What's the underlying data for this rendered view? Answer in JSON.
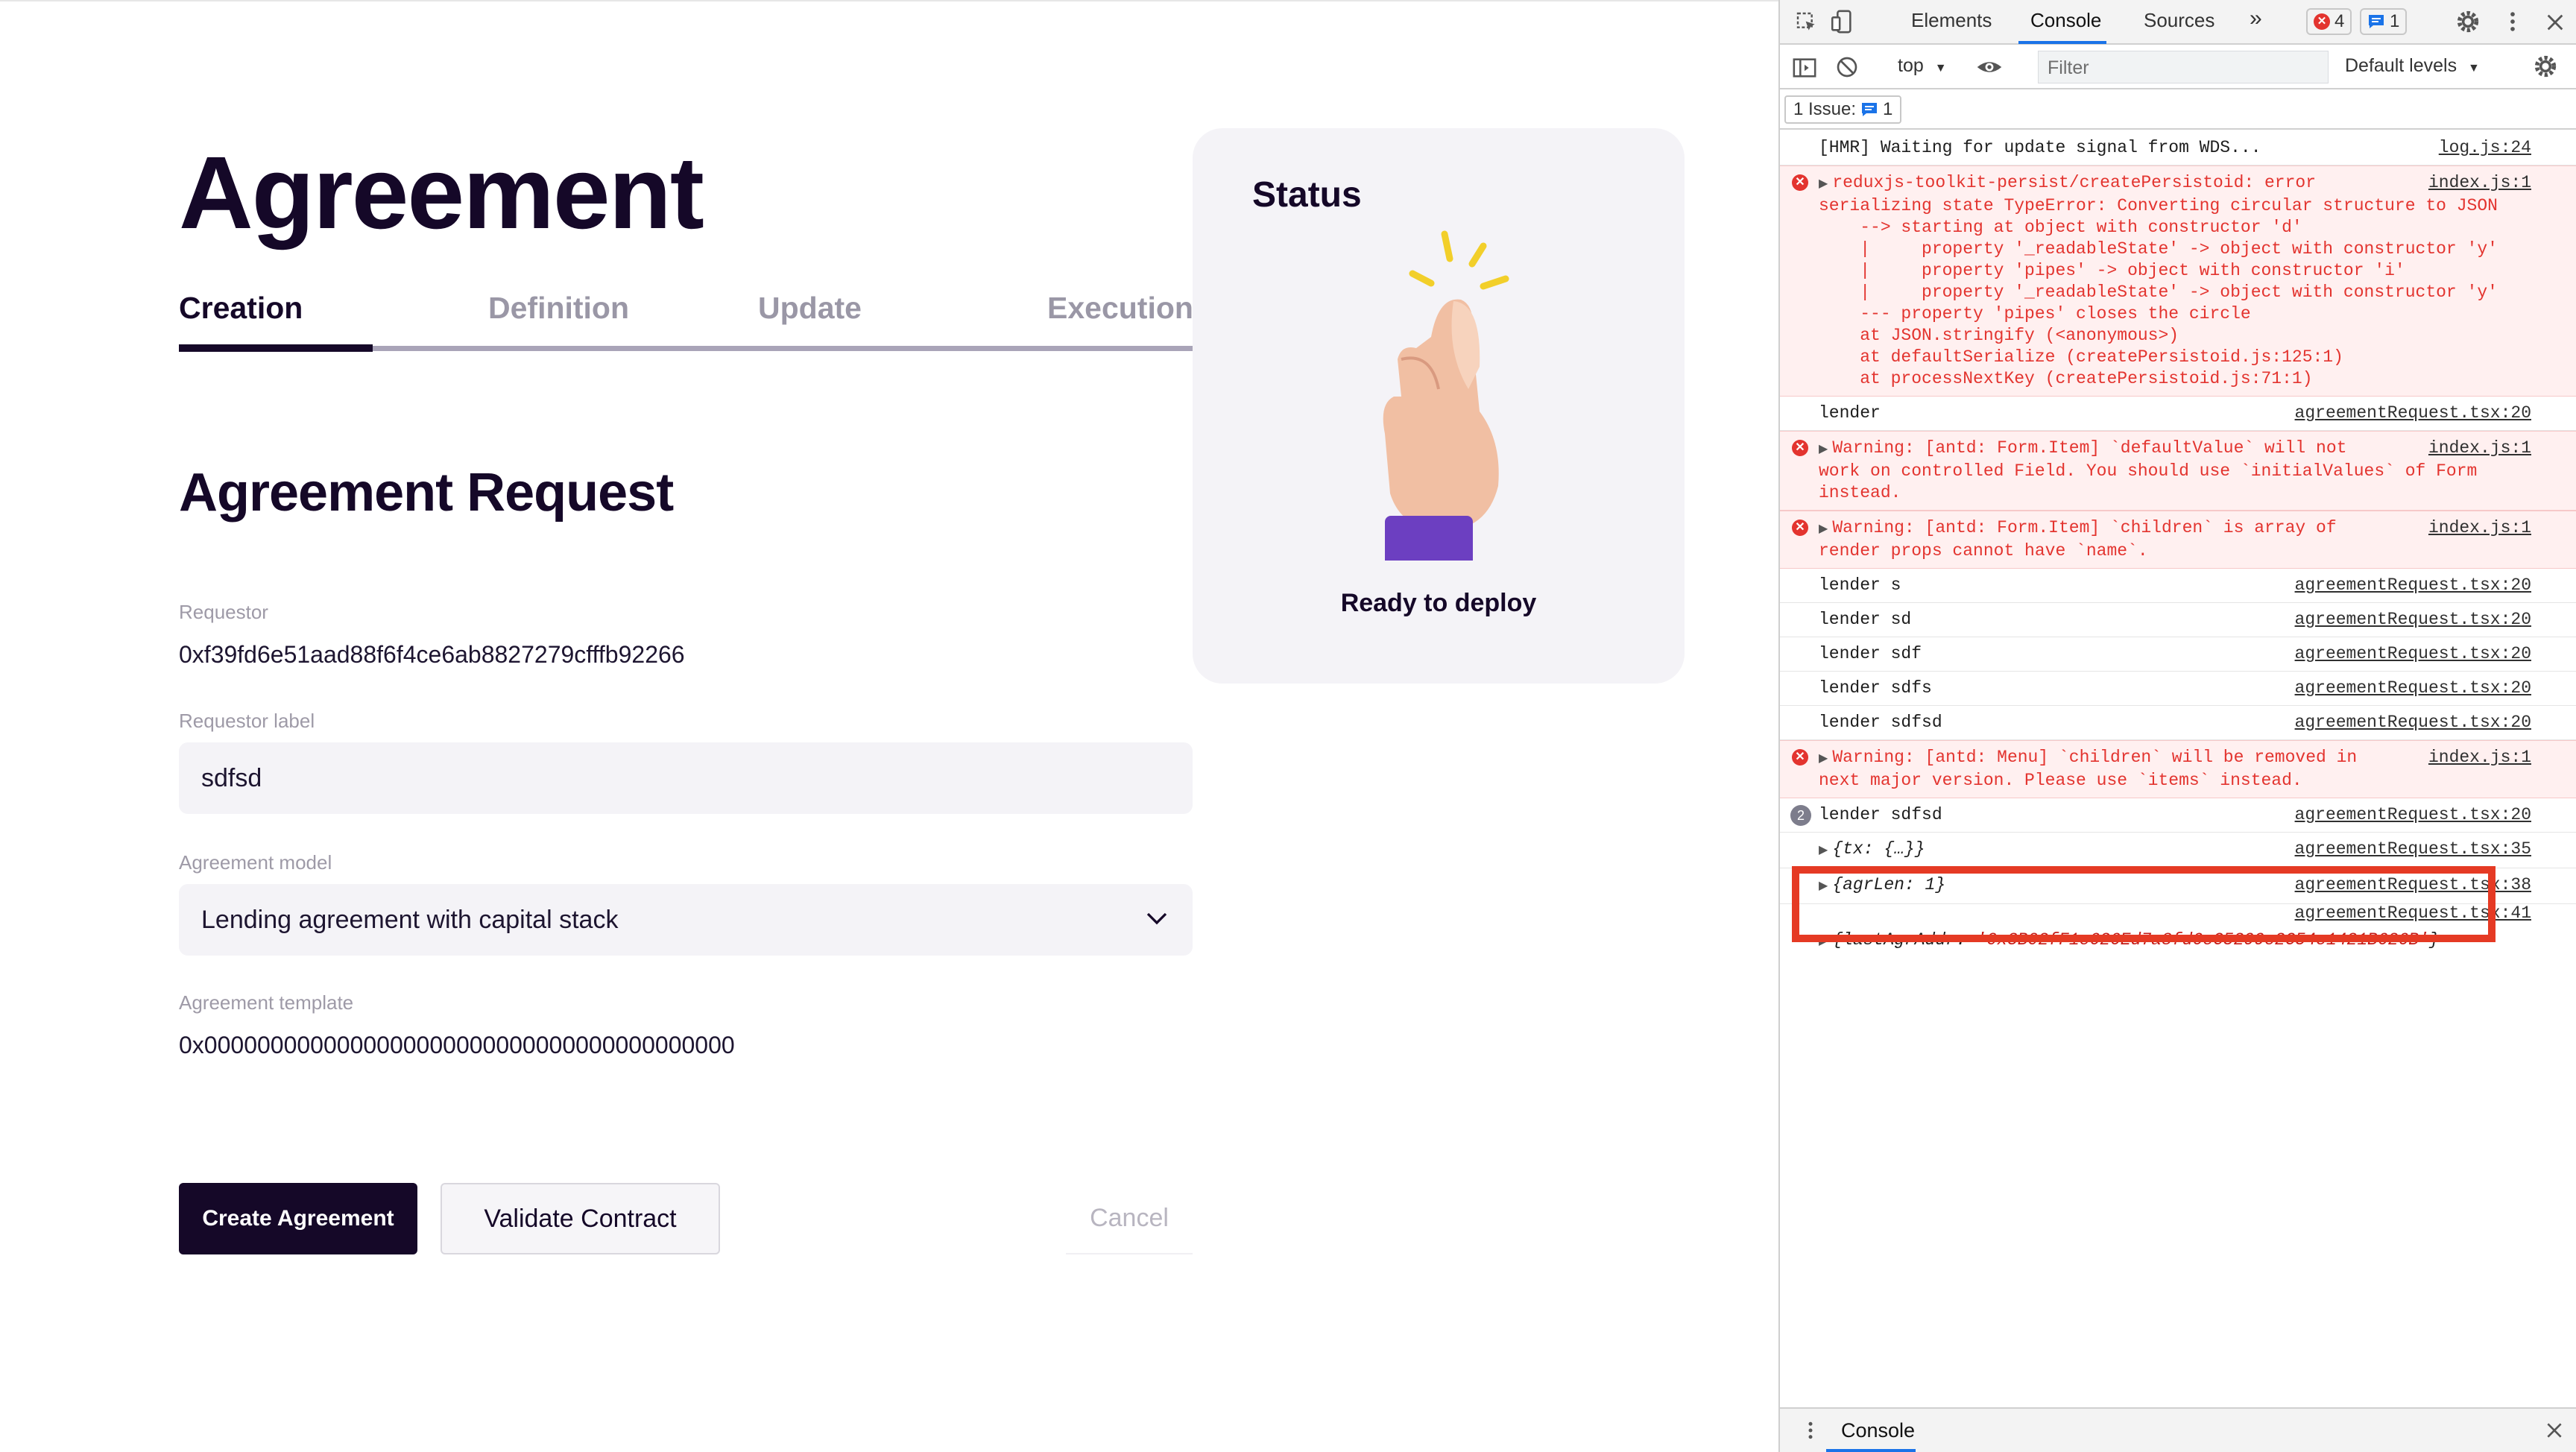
{
  "app": {
    "page_title": "Agreement",
    "tabs": [
      {
        "label": "Creation",
        "active": true
      },
      {
        "label": "Definition",
        "active": false
      },
      {
        "label": "Update",
        "active": false
      },
      {
        "label": "Execution",
        "active": false
      }
    ],
    "section_title": "Agreement Request",
    "fields": {
      "requestor_label": "Requestor",
      "requestor_value": "0xf39fd6e51aad88f6f4ce6ab8827279cfffb92266",
      "requestor_label_label": "Requestor label",
      "requestor_label_value": "sdfsd",
      "agreement_model_label": "Agreement model",
      "agreement_model_value": "Lending agreement with capital stack",
      "agreement_template_label": "Agreement template",
      "agreement_template_value": "0x0000000000000000000000000000000000000000"
    },
    "buttons": {
      "create": "Create Agreement",
      "validate": "Validate Contract",
      "cancel": "Cancel"
    },
    "status": {
      "title": "Status",
      "text": "Ready to deploy",
      "icon": "crossed-fingers-hand-icon"
    }
  },
  "devtools": {
    "tabs": [
      {
        "label": "Elements",
        "active": false
      },
      {
        "label": "Console",
        "active": true
      },
      {
        "label": "Sources",
        "active": false
      }
    ],
    "more_tabs": "»",
    "error_count": "4",
    "message_count": "1",
    "context": "top",
    "filter_placeholder": "Filter",
    "levels": "Default levels",
    "issues_label": "1 Issue:",
    "issues_count": "1",
    "drawer_tab": "Console",
    "colors": {
      "error_text": "#e3342f",
      "error_bg": "#fff0f0",
      "highlight": "#e53a24",
      "accent": "#1a73e8"
    },
    "console": [
      {
        "type": "log",
        "text": "[HMR] Waiting for update signal from WDS...",
        "source": "log.js:24"
      },
      {
        "type": "error",
        "text": "reduxjs-toolkit-persist/createPersistoid: error\nserializing state TypeError: Converting circular structure to JSON\n    --> starting at object with constructor 'd'\n    |     property '_readableState' -> object with constructor 'y'\n    |     property 'pipes' -> object with constructor 'i'\n    |     property '_readableState' -> object with constructor 'y'\n    --- property 'pipes' closes the circle\n    at JSON.stringify (<anonymous>)\n    at defaultSerialize (createPersistoid.js:125:1)\n    at processNextKey (createPersistoid.js:71:1)",
        "source": "index.js:1"
      },
      {
        "type": "log",
        "text": "lender",
        "source": "agreementRequest.tsx:20"
      },
      {
        "type": "error",
        "text": "Warning: [antd: Form.Item] `defaultValue` will not\nwork on controlled Field. You should use `initialValues` of Form\ninstead.",
        "source": "index.js:1"
      },
      {
        "type": "error",
        "text": "Warning: [antd: Form.Item] `children` is array of\nrender props cannot have `name`.",
        "source": "index.js:1"
      },
      {
        "type": "log",
        "text": "lender s",
        "source": "agreementRequest.tsx:20"
      },
      {
        "type": "log",
        "text": "lender sd",
        "source": "agreementRequest.tsx:20"
      },
      {
        "type": "log",
        "text": "lender sdf",
        "source": "agreementRequest.tsx:20"
      },
      {
        "type": "log",
        "text": "lender sdfs",
        "source": "agreementRequest.tsx:20"
      },
      {
        "type": "log",
        "text": "lender sdfsd",
        "source": "agreementRequest.tsx:20"
      },
      {
        "type": "error",
        "text": "Warning: [antd: Menu] `children` will be removed in\nnext major version. Please use `items` instead.",
        "source": "index.js:1"
      },
      {
        "type": "repeat",
        "count": "2",
        "text": "lender sdfsd",
        "source": "agreementRequest.tsx:20"
      },
      {
        "type": "object",
        "text": "{tx: {…}}",
        "source": "agreementRequest.tsx:35"
      },
      {
        "type": "object",
        "text": "{agrLen: 1}",
        "source": "agreementRequest.tsx:38"
      }
    ],
    "last_entry": {
      "source": "agreementRequest.tsx:41",
      "key": "{lastAgrAddr: ",
      "value": "'0x3B02fF1e626Ed7a8fd6eC5299e2C54e1421B626B'",
      "close": "}"
    }
  }
}
